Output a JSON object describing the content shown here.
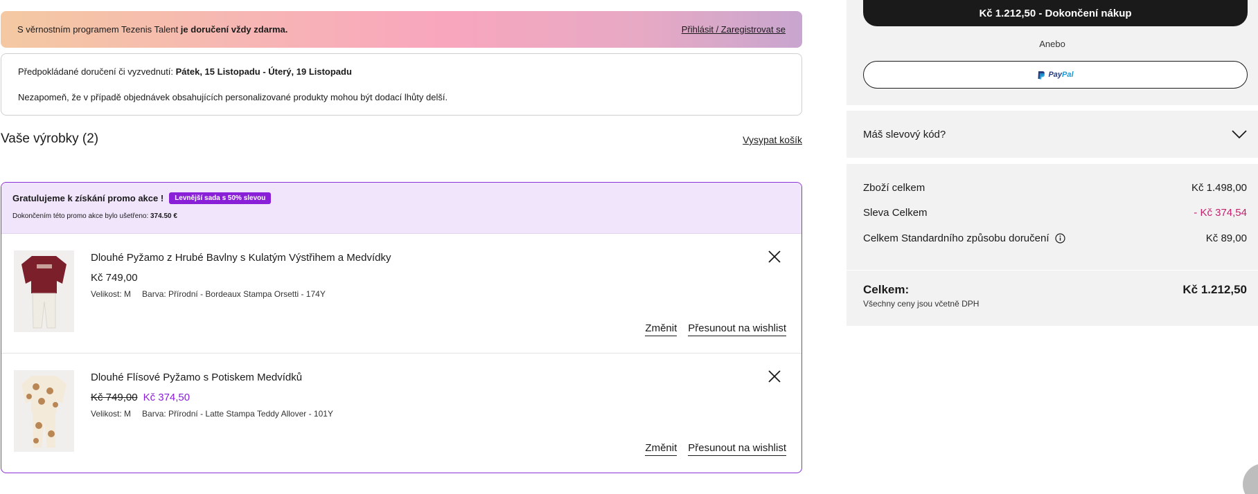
{
  "loyalty_banner": {
    "text_prefix": "S věrnostním programem Tezenis Talent ",
    "text_bold": "je doručení vždy zdarma.",
    "link": "Přihlásit / Zaregistrovat se"
  },
  "delivery": {
    "label": "Předpokládané doručení či vyzvednutí: ",
    "dates": "Pátek, 15 Listopadu - Úterý, 19 Listopadu",
    "note": "Nezapomeň, že v případě objednávek obsahujících personalizované produkty mohou být dodací lhůty delší."
  },
  "products": {
    "title": "Vaše výrobky (2)",
    "empty_cart": "Vysypat košík"
  },
  "promo": {
    "headline": "Gratulujeme k získání promo akce !",
    "badge": "Levnější sada s 50% slevou",
    "saved_prefix": "Dokončením této promo akce bylo ušetřeno: ",
    "saved_value": "374.50 €"
  },
  "items": [
    {
      "name": "Dlouhé Pyžamo z Hrubé Bavlny s Kulatým Výstřihem a Medvídky",
      "price": "Kč 749,00",
      "old_price": "",
      "size": "Velikost: M",
      "color": "Barva: Přírodní - Bordeaux Stampa Orsetti - 174Y",
      "change": "Změnit",
      "wishlist": "Přesunout na wishlist"
    },
    {
      "name": "Dlouhé Flísové Pyžamo s Potiskem Medvídků",
      "old_price": "Kč 749,00",
      "price": "Kč 374,50",
      "size": "Velikost: M",
      "color": "Barva: Přírodní - Latte Stampa Teddy Allover - 101Y",
      "change": "Změnit",
      "wishlist": "Přesunout na wishlist"
    }
  ],
  "checkout": {
    "button": "Kč 1.212,50 - Dokončení nákup",
    "or": "Anebo",
    "paypal_a": "Pay",
    "paypal_b": "Pal"
  },
  "discount": {
    "label": "Máš slevový kód?"
  },
  "summary": {
    "goods_label": "Zboží celkem",
    "goods_value": "Kč 1.498,00",
    "discount_label": "Sleva Celkem",
    "discount_value": "- Kč 374,54",
    "shipping_label": "Celkem Standardního způsobu doručení",
    "shipping_value": "Kč 89,00",
    "total_label": "Celkem:",
    "total_value": "Kč 1.212,50",
    "vat_note": "Všechny ceny jsou včetně DPH"
  },
  "colors": {
    "accent_purple": "#8a1fd8",
    "discount_pink": "#c4216c",
    "checkout_black": "#1a1a1a"
  }
}
